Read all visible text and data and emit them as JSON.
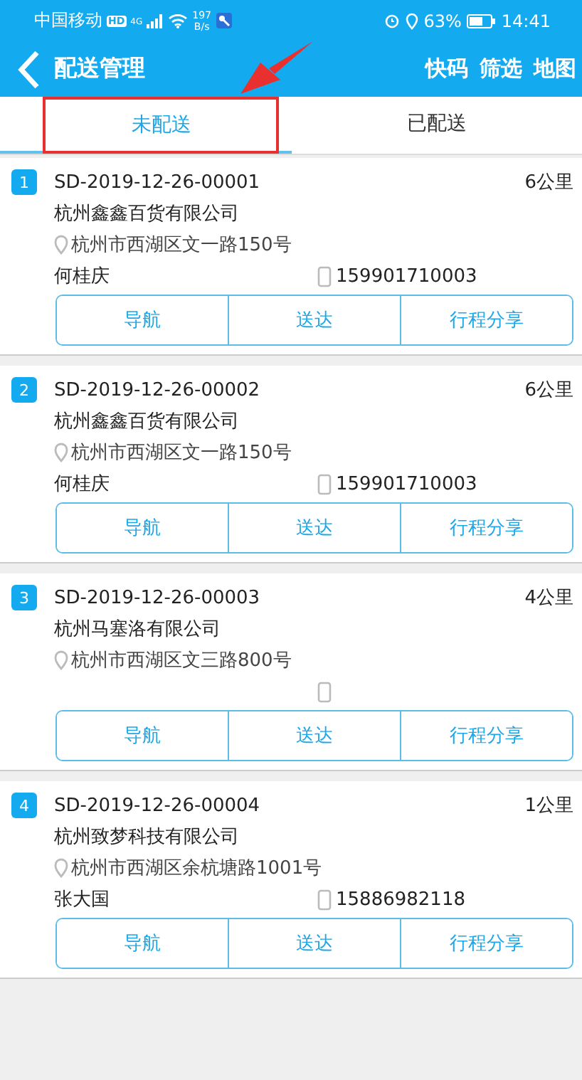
{
  "status_bar": {
    "carrier": "中国移动",
    "hd": "HD",
    "net_type": "4G",
    "speed_value": "197",
    "speed_unit": "B/s",
    "battery": "63%",
    "time": "14:41"
  },
  "header": {
    "title": "配送管理",
    "actions": [
      "快码",
      "筛选",
      "地图"
    ]
  },
  "tabs": [
    {
      "label": "未配送",
      "selected": true,
      "highlighted": true
    },
    {
      "label": "已配送",
      "selected": false,
      "highlighted": false
    }
  ],
  "orders": [
    {
      "index": "1",
      "code": "SD-2019-12-26-00001",
      "distance": "6公里",
      "company": "杭州鑫鑫百货有限公司",
      "address": "杭州市西湖区文一路150号",
      "contact": "何桂庆",
      "phone": "159901710003",
      "buttons": [
        "导航",
        "送达",
        "行程分享"
      ]
    },
    {
      "index": "2",
      "code": "SD-2019-12-26-00002",
      "distance": "6公里",
      "company": "杭州鑫鑫百货有限公司",
      "address": "杭州市西湖区文一路150号",
      "contact": "何桂庆",
      "phone": "159901710003",
      "buttons": [
        "导航",
        "送达",
        "行程分享"
      ]
    },
    {
      "index": "3",
      "code": "SD-2019-12-26-00003",
      "distance": "4公里",
      "company": "杭州马塞洛有限公司",
      "address": "杭州市西湖区文三路800号",
      "buttons": [
        "导航",
        "送达",
        "行程分享"
      ]
    },
    {
      "index": "4",
      "code": "SD-2019-12-26-00004",
      "distance": "1公里",
      "company": "杭州致梦科技有限公司",
      "address": "杭州市西湖区余杭塘路1001号",
      "contact": "张大国",
      "phone": "15886982118",
      "buttons": [
        "导航",
        "送达",
        "行程分享"
      ]
    }
  ]
}
